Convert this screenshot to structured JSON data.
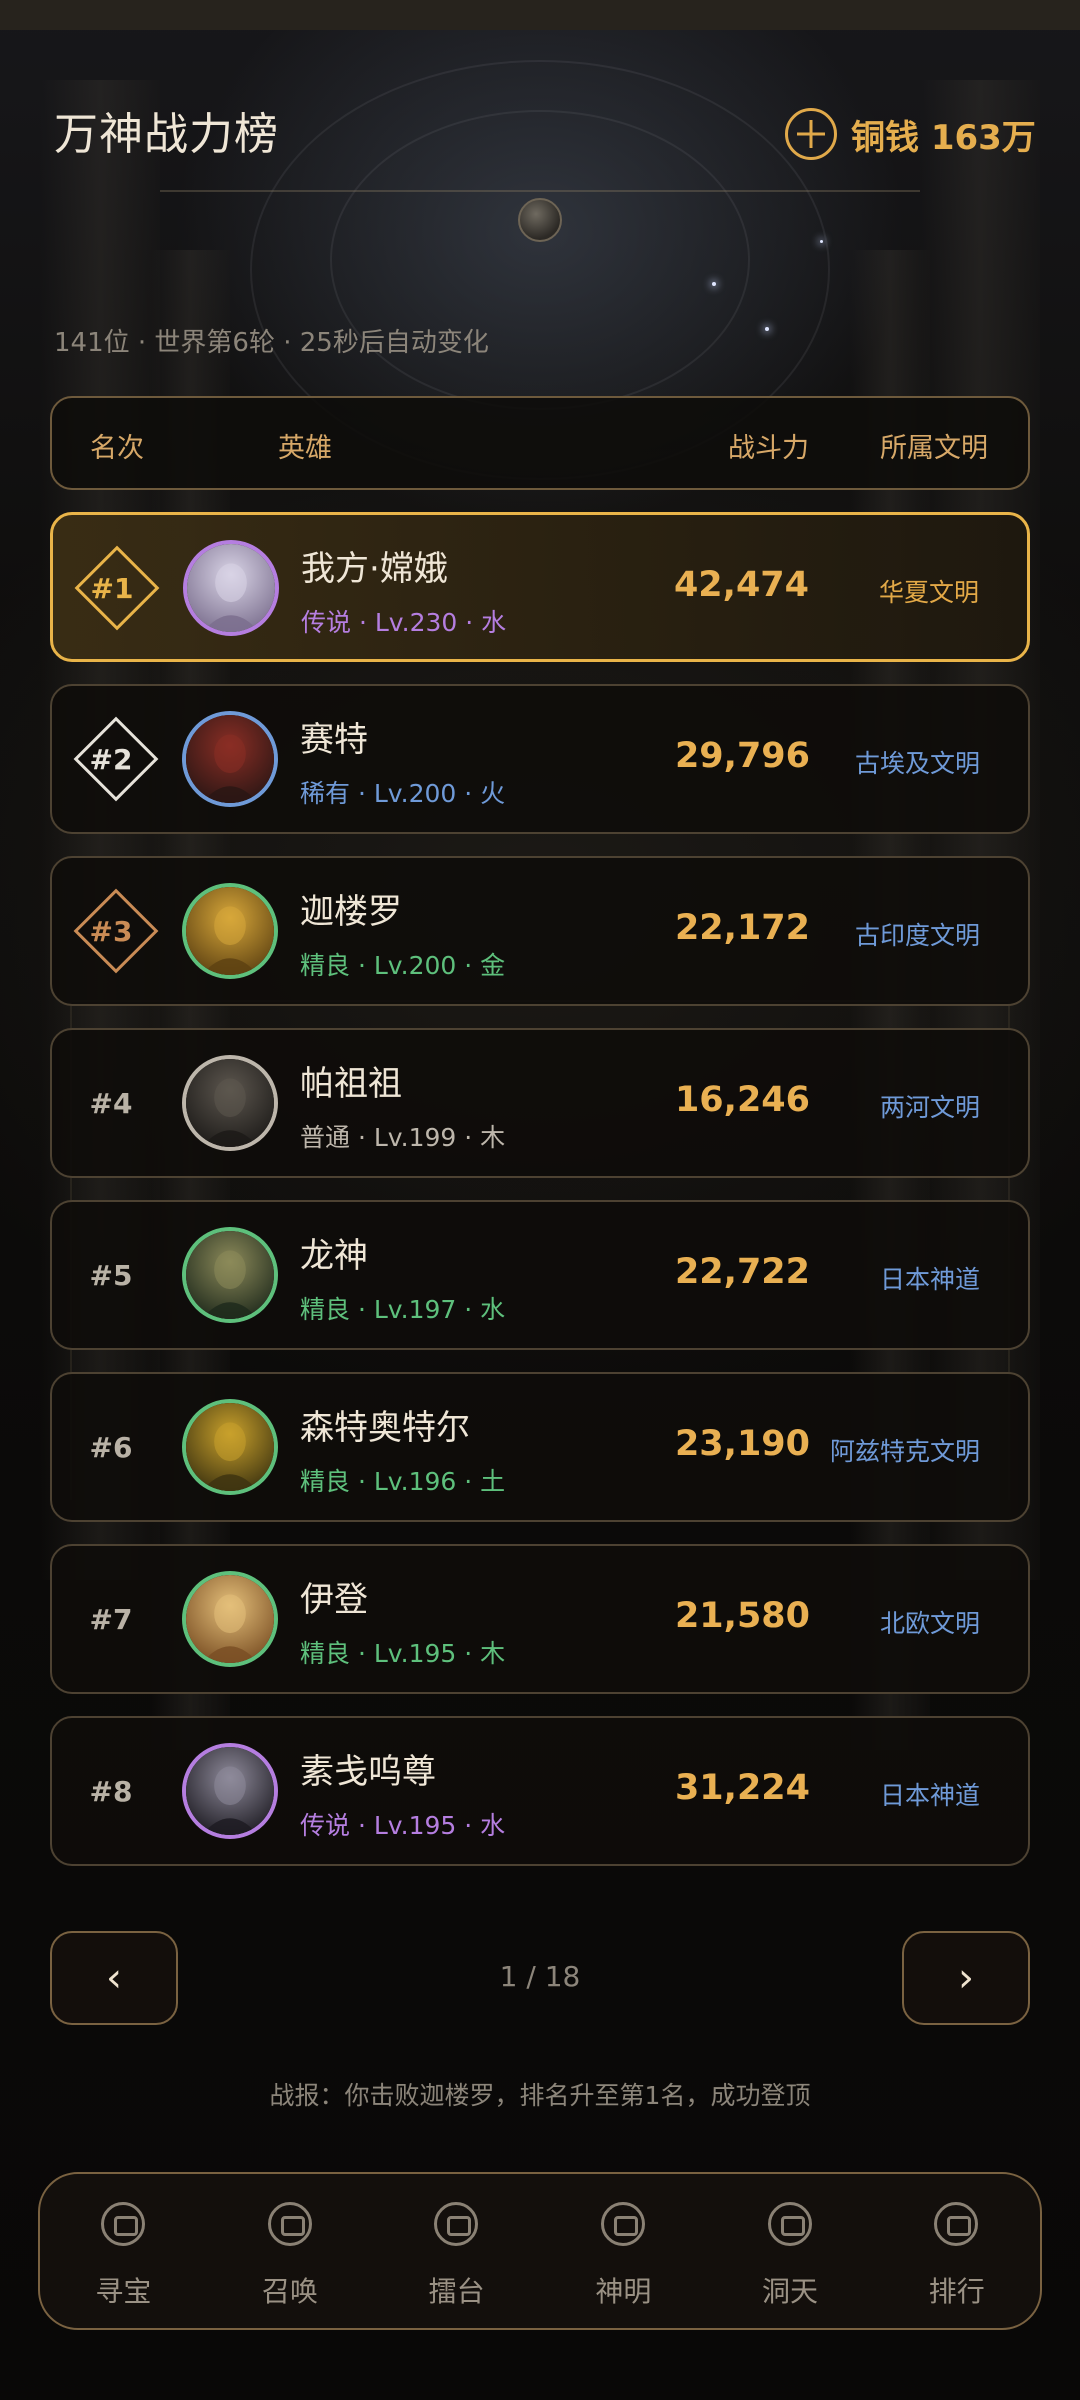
{
  "header": {
    "title": "万神战力榜",
    "currency_label": "铜钱 163万",
    "subtitle": "141位 · 世界第6轮 · 25秒后自动变化"
  },
  "table_header": {
    "rank": "名次",
    "hero": "英雄",
    "power": "战斗力",
    "civilization": "所属文明"
  },
  "rows": [
    {
      "rank": "#1",
      "name": "我方·嫦娥",
      "meta": "传说 · Lv.230 · 水",
      "power": "42,474",
      "civ": "华夏文明",
      "rarity_color": "#b57ee0",
      "badge_color": "#e9b449",
      "avatar_colors": [
        "#d9d4e6",
        "#7b6f8e"
      ]
    },
    {
      "rank": "#2",
      "name": "赛特",
      "meta": "稀有 · Lv.200 · 火",
      "power": "29,796",
      "civ": "古埃及文明",
      "rarity_color": "#6f9ad8",
      "badge_color": "#e6e2da",
      "avatar_colors": [
        "#8a2e25",
        "#2a1614"
      ]
    },
    {
      "rank": "#3",
      "name": "迦楼罗",
      "meta": "精良 · Lv.200 · 金",
      "power": "22,172",
      "civ": "古印度文明",
      "rarity_color": "#5ec07c",
      "badge_color": "#c98b55",
      "avatar_colors": [
        "#d7a73a",
        "#5e4212"
      ]
    },
    {
      "rank": "#4",
      "name": "帕祖祖",
      "meta": "普通 · Lv.199 · 木",
      "power": "16,246",
      "civ": "两河文明",
      "rarity_color": "#bdb6ab",
      "badge_color": "",
      "avatar_colors": [
        "#5d574f",
        "#1c1a18"
      ]
    },
    {
      "rank": "#5",
      "name": "龙神",
      "meta": "精良 · Lv.197 · 水",
      "power": "22,722",
      "civ": "日本神道",
      "rarity_color": "#5ec07c",
      "badge_color": "",
      "avatar_colors": [
        "#8c8a5a",
        "#1f2a1c"
      ]
    },
    {
      "rank": "#6",
      "name": "森特奥特尔",
      "meta": "精良 · Lv.196 · 土",
      "power": "23,190",
      "civ": "阿兹特克文明",
      "rarity_color": "#5ec07c",
      "badge_color": "",
      "avatar_colors": [
        "#c9a12c",
        "#3e3410"
      ]
    },
    {
      "rank": "#7",
      "name": "伊登",
      "meta": "精良 · Lv.195 · 木",
      "power": "21,580",
      "civ": "北欧文明",
      "rarity_color": "#5ec07c",
      "badge_color": "",
      "avatar_colors": [
        "#e4bf7a",
        "#7a4f24"
      ]
    },
    {
      "rank": "#8",
      "name": "素戋呜尊",
      "meta": "传说 · Lv.195 · 水",
      "power": "31,224",
      "civ": "日本神道",
      "rarity_color": "#b57ee0",
      "badge_color": "",
      "avatar_colors": [
        "#8e8a9a",
        "#1d1b22"
      ]
    }
  ],
  "pagination": {
    "prev": "‹",
    "next": "›",
    "page": "1 / 18"
  },
  "battle_report": "战报：你击败迦楼罗，排名升至第1名，成功登顶",
  "nav": [
    {
      "label": "寻宝",
      "icon": "treasure-icon",
      "active": false
    },
    {
      "label": "召唤",
      "icon": "summon-icon",
      "active": false
    },
    {
      "label": "擂台",
      "icon": "arena-icon",
      "active": false
    },
    {
      "label": "神明",
      "icon": "deity-icon",
      "active": false
    },
    {
      "label": "洞天",
      "icon": "cave-icon",
      "active": false
    },
    {
      "label": "排行",
      "icon": "ranking-icon",
      "active": true
    }
  ]
}
